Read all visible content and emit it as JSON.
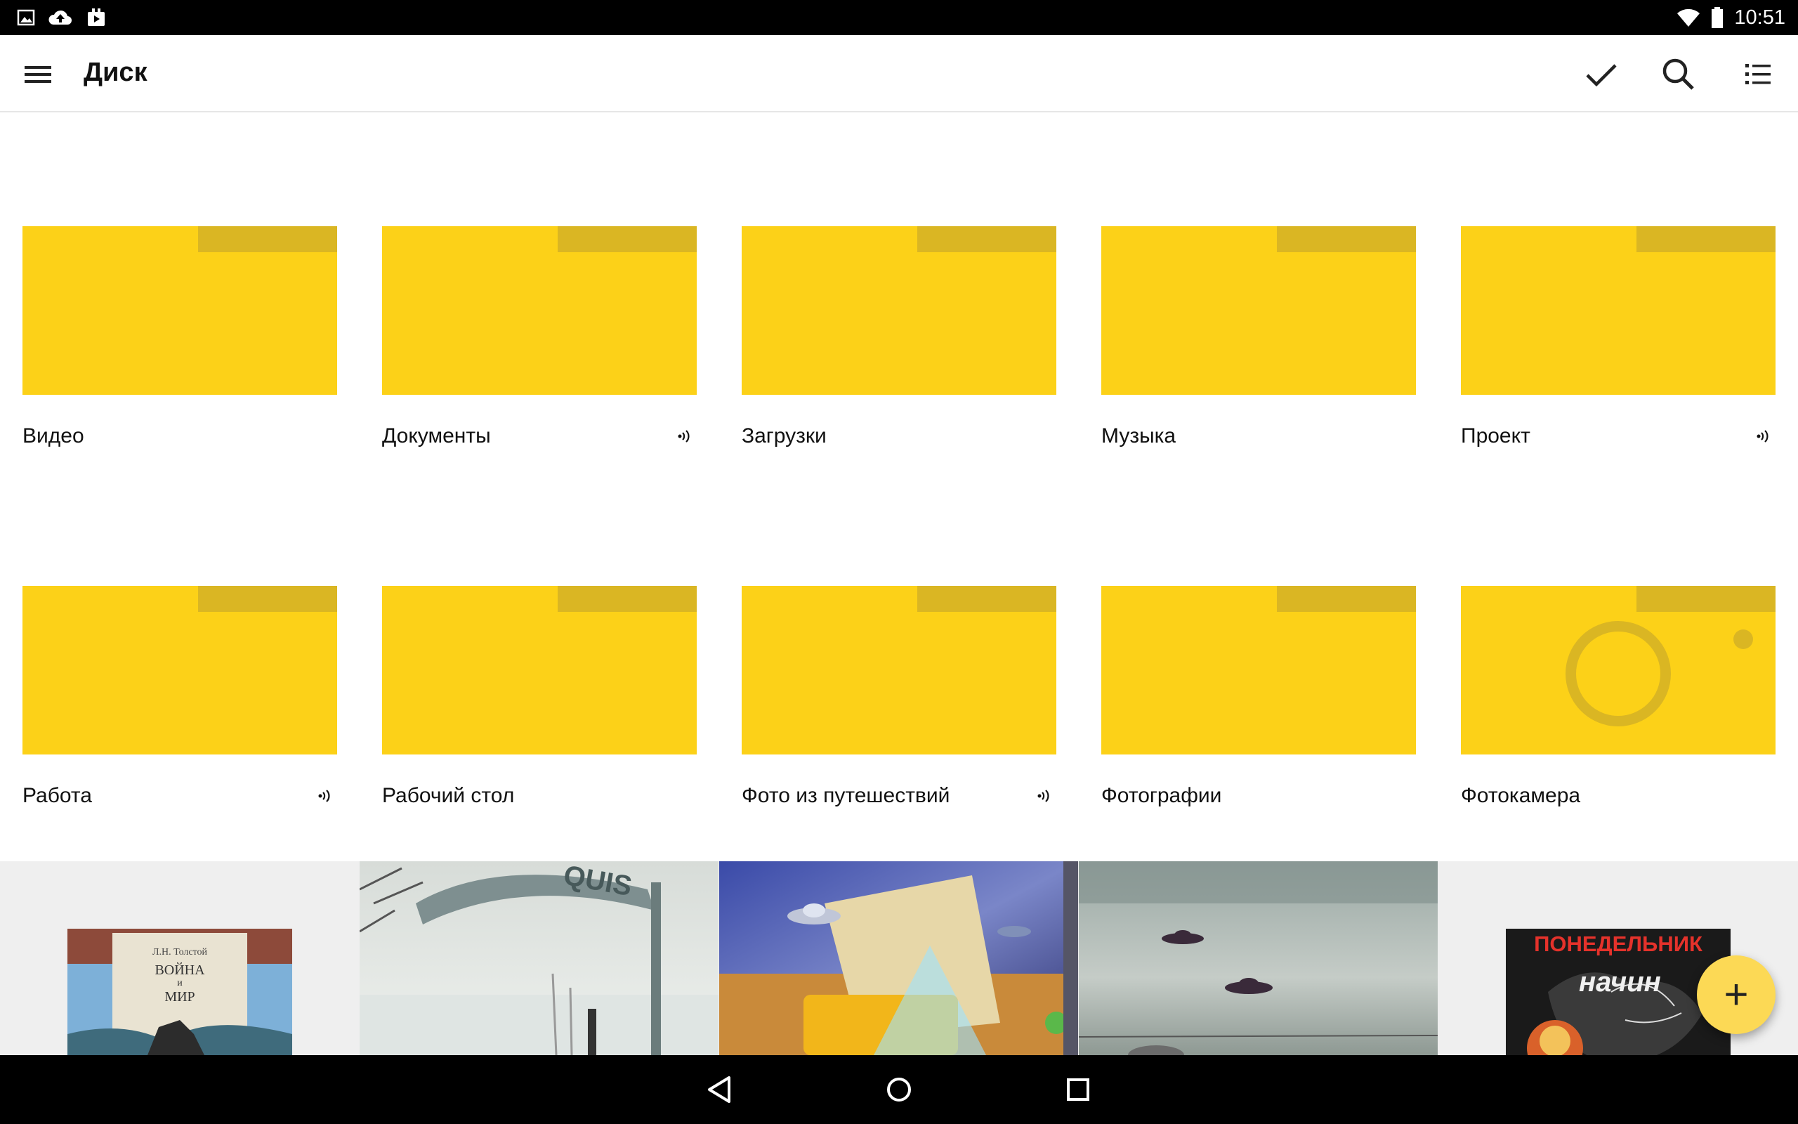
{
  "status_bar": {
    "time": "10:51",
    "left_icons": [
      "image-icon",
      "cloud-upload-icon",
      "download-queue-icon"
    ],
    "right_icons": [
      "wifi-icon",
      "battery-icon"
    ]
  },
  "app_bar": {
    "title": "Диск",
    "actions": [
      "check-icon",
      "search-icon",
      "list-view-icon"
    ]
  },
  "folders": [
    {
      "name": "Видео",
      "shared": false
    },
    {
      "name": "Документы",
      "shared": true
    },
    {
      "name": "Загрузки",
      "shared": false
    },
    {
      "name": "Музыка",
      "shared": false
    },
    {
      "name": "Проект",
      "shared": true
    },
    {
      "name": "Работа",
      "shared": true
    },
    {
      "name": "Рабочий стол",
      "shared": false
    },
    {
      "name": "Фото из путешествий",
      "shared": true
    },
    {
      "name": "Фотографии",
      "shared": false
    },
    {
      "name": "Фотокамера",
      "shared": false,
      "camera": true
    }
  ],
  "photos": {
    "book1": {
      "author": "Л.Н. Толстой",
      "title_line1": "ВОЙНА",
      "title_line2": "и",
      "title_line3": "МИР"
    },
    "sign_text": "QUIS",
    "book2": {
      "title": "ПОНЕДЕЛЬНИК",
      "subtitle": "начин"
    }
  },
  "fab": {
    "label": "+"
  },
  "colors": {
    "folder": "#fcd118",
    "folder_tab": "#dab623",
    "fab": "#fcd955"
  }
}
